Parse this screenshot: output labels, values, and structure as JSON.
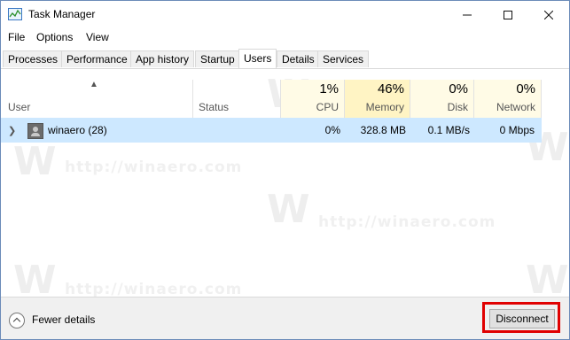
{
  "window": {
    "title": "Task Manager"
  },
  "menu": [
    "File",
    "Options",
    "View"
  ],
  "tabs": [
    "Processes",
    "Performance",
    "App history",
    "Startup",
    "Users",
    "Details",
    "Services"
  ],
  "active_tab": "Users",
  "columns": {
    "user": "User",
    "status": "Status",
    "cpu": {
      "pct": "1%",
      "label": "CPU"
    },
    "memory": {
      "pct": "46%",
      "label": "Memory"
    },
    "disk": {
      "pct": "0%",
      "label": "Disk"
    },
    "network": {
      "pct": "0%",
      "label": "Network"
    }
  },
  "rows": [
    {
      "user": "winaero (28)",
      "status": "",
      "cpu": "0%",
      "memory": "328.8 MB",
      "disk": "0.1 MB/s",
      "network": "0 Mbps"
    }
  ],
  "footer": {
    "fewer_details": "Fewer details",
    "disconnect": "Disconnect"
  },
  "watermark": {
    "text": "http://winaero.com",
    "logo": "W"
  },
  "colors": {
    "selected_row": "#cde8ff",
    "highlight_border": "#e00000",
    "heat_column": "#fff4c4"
  }
}
